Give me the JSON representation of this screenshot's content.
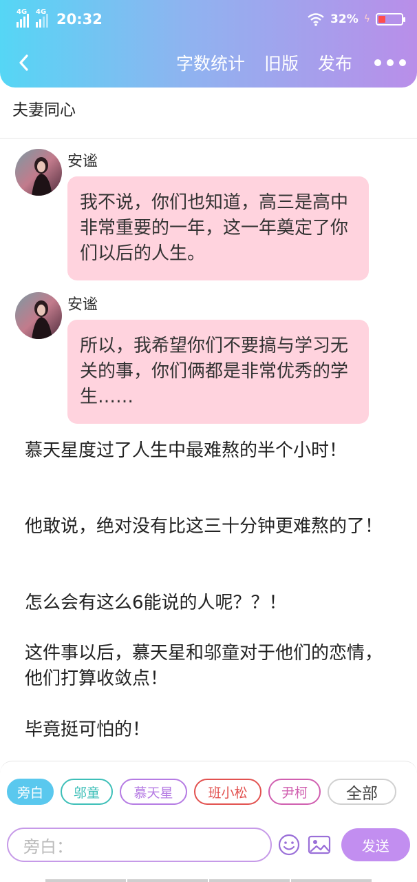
{
  "status_bar": {
    "network_1": "4G",
    "network_2": "4G",
    "time": "20:32",
    "battery_percent": "32%"
  },
  "header": {
    "word_count_label": "字数统计",
    "old_version_label": "旧版",
    "publish_label": "发布"
  },
  "chapter_title": "夫妻同心",
  "messages": [
    {
      "speaker": "安谧",
      "text": "我不说，你们也知道，高三是高中非常重要的一年，这一年奠定了你们以后的人生。"
    },
    {
      "speaker": "安谧",
      "text": "所以，我希望你们不要搞与学习无关的事，你们俩都是非常优秀的学生……"
    }
  ],
  "narration": [
    "慕天星度过了人生中最难熬的半个小时！",
    "他敢说，绝对没有比这三十分钟更难熬的了！",
    "怎么会有这么6能说的人呢？？！",
    "这件事以后，慕天星和邬童对于他们的恋情，他们打算收敛点！",
    "毕竟挺可怕的！"
  ],
  "role_chips": [
    {
      "label": "旁白",
      "color": "#5ac8ee"
    },
    {
      "label": "邬童",
      "color": "#3dbfb8"
    },
    {
      "label": "慕天星",
      "color": "#b57be3"
    },
    {
      "label": "班小松",
      "color": "#e2514f"
    },
    {
      "label": "尹柯",
      "color": "#d05fb0"
    },
    {
      "label": "全部",
      "color": "#d0d0d0"
    }
  ],
  "composer": {
    "placeholder": "旁白：",
    "send_label": "发送"
  }
}
